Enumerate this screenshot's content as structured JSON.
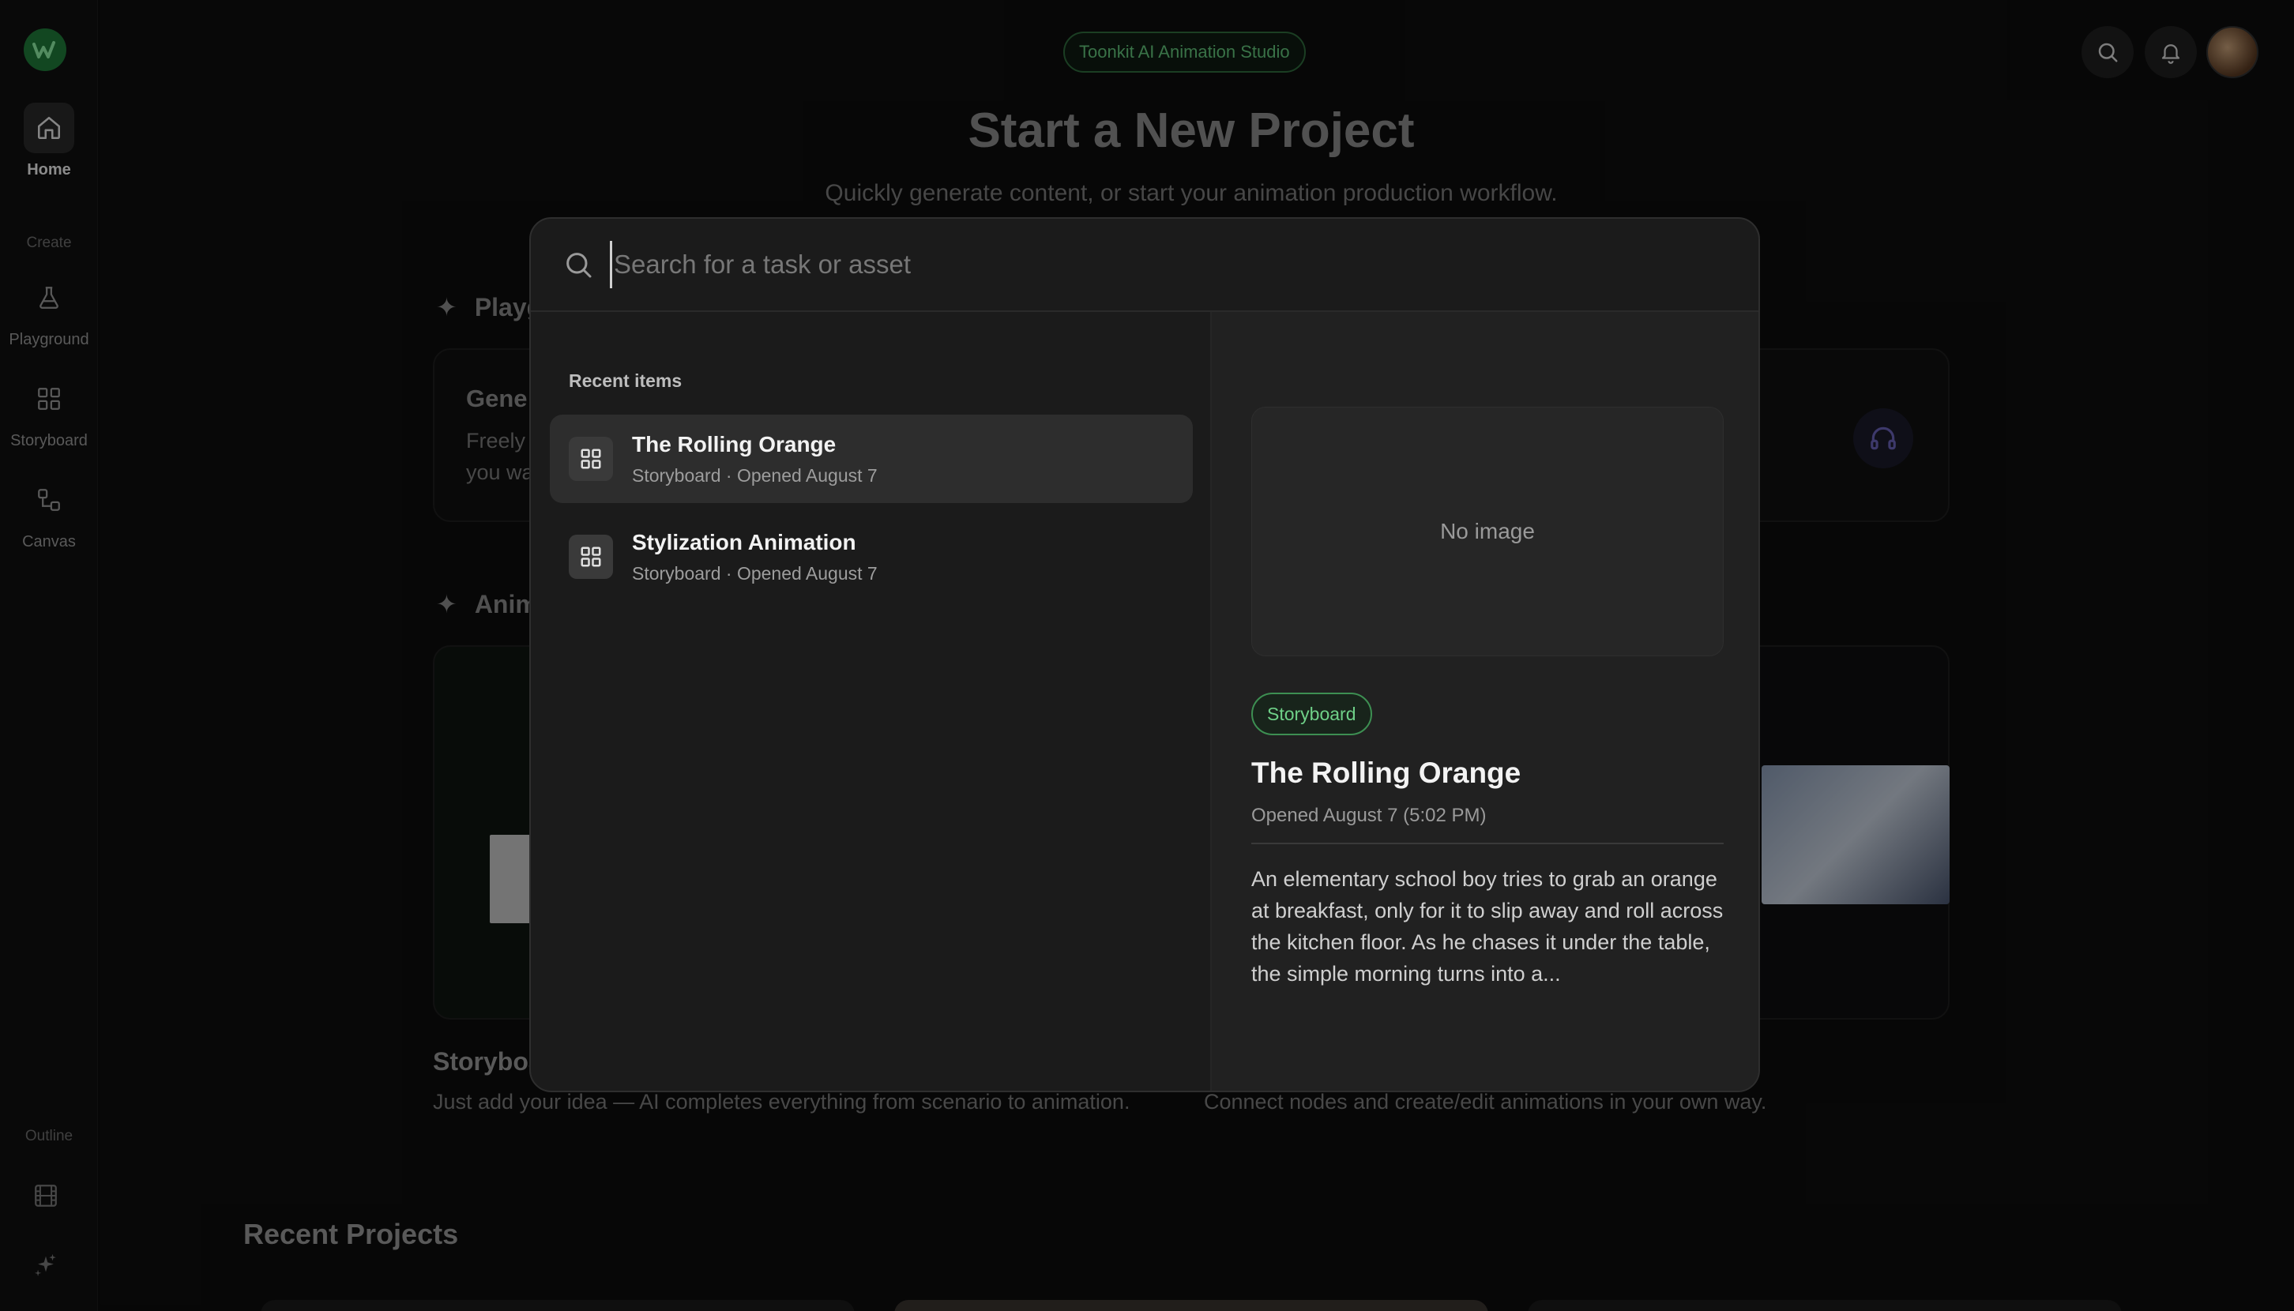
{
  "app": {
    "badge": "Toonkit AI Animation Studio"
  },
  "sidebar": {
    "home": "Home",
    "create_section": "Create",
    "playground": "Playground",
    "storyboard": "Storyboard",
    "canvas": "Canvas",
    "outline_section": "Outline"
  },
  "page": {
    "title": "Start a New Project",
    "subtitle": "Quickly generate content, or start your animation production workflow.",
    "section1_partial": "Playg",
    "section2_partial": "Anim",
    "card1_title_partial": "Gene",
    "card1_line1_partial": "Freely",
    "card1_line2_partial": "you wa",
    "storyboard_label_partial": "Storyboa",
    "storyboard_desc": "Just add your idea — AI completes everything from scenario to animation.",
    "canvas_desc": "Connect nodes and create/edit animations in your own way.",
    "recent_projects": "Recent Projects"
  },
  "search": {
    "placeholder": "Search for a task or asset",
    "value": ""
  },
  "recent": {
    "label": "Recent items",
    "items": [
      {
        "title": "The Rolling Orange",
        "meta": "Storyboard · Opened August 7"
      },
      {
        "title": "Stylization Animation",
        "meta": "Storyboard · Opened August 7"
      }
    ]
  },
  "preview": {
    "image_text": "No image",
    "type": "Storyboard",
    "title": "The Rolling Orange",
    "opened": "Opened August 7 (5:02 PM)",
    "description": "An elementary school boy tries to grab an orange at breakfast, only for it to slip away and roll across the kitchen floor. As he chases it under the table, the simple morning turns into a..."
  },
  "colors": {
    "accent_green": "#62c47b",
    "background": "#0d0d0d",
    "modal": "#1b1b1b"
  }
}
